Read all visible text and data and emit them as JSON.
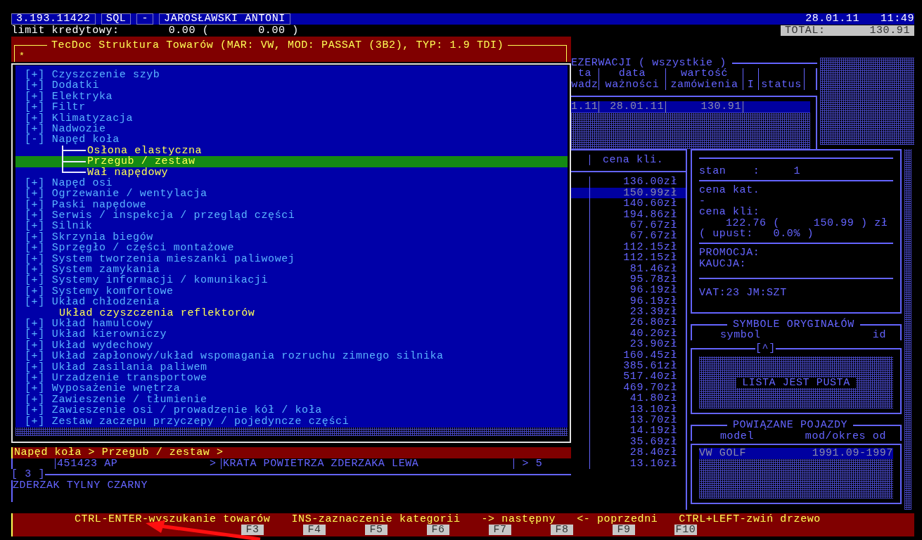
{
  "header": {
    "segments": [
      "3.193.11422",
      "SQL",
      "-",
      "JAROSŁAWSKI ANTONI"
    ],
    "date": "28.01.11",
    "time": "11:49",
    "credit_label": "limit kredytowy:",
    "credit_value": "0.00 (",
    "credit_value_2": "0.00 )",
    "total_label": "TOTAL:",
    "total_value": "130.91"
  },
  "tree_window": {
    "title": "TecDoc Struktura Towarów (MAR: VW, MOD: PASSAT (3B2), TYP: 1.9 TDI)",
    "filter": "*",
    "items": [
      {
        "toggle": "[+]",
        "label": "Czyszczenie szyb",
        "selected": false
      },
      {
        "toggle": "[+]",
        "label": "Dodatki",
        "selected": false
      },
      {
        "toggle": "[+]",
        "label": "Elektryka",
        "selected": false
      },
      {
        "toggle": "[+]",
        "label": "Filtr",
        "selected": false
      },
      {
        "toggle": "[+]",
        "label": "Klimatyzacja",
        "selected": false
      },
      {
        "toggle": "[+]",
        "label": "Nadwozie",
        "selected": false
      },
      {
        "toggle": "[-]",
        "label": "Napęd koła",
        "selected": false,
        "children": [
          {
            "label": "Osłona elastyczna",
            "selected": false
          },
          {
            "label": "Przegub / zestaw",
            "selected": true
          },
          {
            "label": "Wał napędowy",
            "selected": false
          }
        ]
      },
      {
        "toggle": "[+]",
        "label": "Napęd osi",
        "selected": false
      },
      {
        "toggle": "[+]",
        "label": "Ogrzewanie / wentylacja",
        "selected": false
      },
      {
        "toggle": "[+]",
        "label": "Paski napędowe",
        "selected": false
      },
      {
        "toggle": "[+]",
        "label": "Serwis / inspekcja / przegląd części",
        "selected": false
      },
      {
        "toggle": "[+]",
        "label": "Silnik",
        "selected": false
      },
      {
        "toggle": "[+]",
        "label": "Skrzynia biegów",
        "selected": false
      },
      {
        "toggle": "[+]",
        "label": "Sprzęgło / części montażowe",
        "selected": false
      },
      {
        "toggle": "[+]",
        "label": "System tworzenia mieszanki paliwowej",
        "selected": false
      },
      {
        "toggle": "[+]",
        "label": "System zamykania",
        "selected": false
      },
      {
        "toggle": "[+]",
        "label": "Systemy informacji / komunikacji",
        "selected": false
      },
      {
        "toggle": "[+]",
        "label": "Systemy komfortowe",
        "selected": false
      },
      {
        "toggle": "[+]",
        "label": "Układ chłodzenia",
        "selected": false
      },
      {
        "label": "Układ czyszczenia reflektorów",
        "selected": false
      },
      {
        "toggle": "[+]",
        "label": "Układ hamulcowy",
        "selected": false
      },
      {
        "toggle": "[+]",
        "label": "Układ kierowniczy",
        "selected": false
      },
      {
        "toggle": "[+]",
        "label": "Układ wydechowy",
        "selected": false
      },
      {
        "toggle": "[+]",
        "label": "Układ zapłonowy/układ wspomagania rozruchu zimnego silnika",
        "selected": false
      },
      {
        "toggle": "[+]",
        "label": "Układ zasilania paliwem",
        "selected": false
      },
      {
        "toggle": "[+]",
        "label": "Urzadzenie transportowe",
        "selected": false
      },
      {
        "toggle": "[+]",
        "label": "Wyposażenie wnętrza",
        "selected": false
      },
      {
        "toggle": "[+]",
        "label": "Zawieszenie / tłumienie",
        "selected": false
      },
      {
        "toggle": "[+]",
        "label": "Zawieszenie osi / prowadzenie kół / koła",
        "selected": false
      },
      {
        "toggle": "[+]",
        "label": "Zestaw zaczepu przyczepy / pojedyncze części",
        "selected": false
      }
    ]
  },
  "breadcrumb": "Napęd koła > Przegub / zestaw >",
  "item_row": {
    "code": "451423 AP",
    "arrow": ">",
    "name": "KRATA POWIETRZA ZDERZAKA LEWA",
    "column_4": "> 5"
  },
  "counter": "[ 3 ]",
  "note": "ZDERZAK TYLNY CZARNY",
  "reservations": {
    "title": "EZERWACJI ( wszystkie )",
    "columns": [
      {
        "lines": [
          "ta",
          "wadz"
        ]
      },
      {
        "lines": [
          "data",
          "ważności"
        ]
      },
      {
        "lines": [
          "wartość",
          "zamówienia"
        ]
      },
      {
        "lines": [
          "I"
        ]
      },
      {
        "lines": [
          "status"
        ]
      }
    ],
    "rows": [
      {
        "cells": [
          "1.11",
          "28.01.11",
          "130.91"
        ],
        "selected": true
      }
    ]
  },
  "prices": {
    "header": "cena kli.",
    "rows": [
      {
        "value": "136.00zł",
        "selected": false
      },
      {
        "value": "150.99zł",
        "selected": true
      },
      {
        "value": "140.60zł",
        "selected": false
      },
      {
        "value": "194.86zł",
        "selected": false
      },
      {
        "value": "67.67zł",
        "selected": false
      },
      {
        "value": "67.67zł",
        "selected": false
      },
      {
        "value": "112.15zł",
        "selected": false
      },
      {
        "value": "112.15zł",
        "selected": false
      },
      {
        "value": "81.46zł",
        "selected": false
      },
      {
        "value": "95.78zł",
        "selected": false
      },
      {
        "value": "96.19zł",
        "selected": false
      },
      {
        "value": "96.19zł",
        "selected": false
      },
      {
        "value": "23.39zł",
        "selected": false
      },
      {
        "value": "26.80zł",
        "selected": false
      },
      {
        "value": "40.20zł",
        "selected": false
      },
      {
        "value": "23.90zł",
        "selected": false
      },
      {
        "value": "160.45zł",
        "selected": false
      },
      {
        "value": "385.61zł",
        "selected": false
      },
      {
        "value": "517.40zł",
        "selected": false
      },
      {
        "value": "469.70zł",
        "selected": false
      },
      {
        "value": "41.80zł",
        "selected": false
      },
      {
        "value": "13.10zł",
        "selected": false
      },
      {
        "value": "13.70zł",
        "selected": false
      },
      {
        "value": "14.19zł",
        "selected": false
      },
      {
        "value": "35.69zł",
        "selected": false
      },
      {
        "value": "28.40zł",
        "selected": false
      },
      {
        "value": "13.10zł",
        "selected": false
      }
    ]
  },
  "details": {
    "stock_label": "stan",
    "stock_value": ":     1",
    "catalog_label": "cena kat.",
    "catalog_value": "-",
    "client_label": "cena kli:",
    "client_net": "122.76 (",
    "client_gross": "150.99 ) zł",
    "discount": "( upust:   0.0% )",
    "promo": "PROMOCJA:",
    "deposit": "KAUCJA:",
    "vat": "VAT:23 JM:SZT"
  },
  "originals": {
    "title": "SYMBOLE ORYGINAŁÓW",
    "columns": [
      "symbol",
      "id"
    ],
    "scroll_marker": "[^]",
    "empty": "LISTA JEST PUSTA"
  },
  "vehicles": {
    "title": "POWIĄZANE POJAZDY",
    "columns": [
      "model",
      "mod/okres od"
    ],
    "rows": [
      {
        "model": "VW GOLF",
        "period": "1991.09-1997",
        "selected": true
      }
    ]
  },
  "status_bar": {
    "hints": [
      "CTRL-ENTER-wyszukanie towarów",
      "INS-zaznaczenie kategorii",
      "-> następny",
      "<- poprzedni",
      "CTRL+LEFT-zwiń drzewo"
    ],
    "keys": [
      "F3",
      "F4",
      "F5",
      "F6",
      "F7",
      "F8",
      "F9",
      "F10"
    ]
  }
}
